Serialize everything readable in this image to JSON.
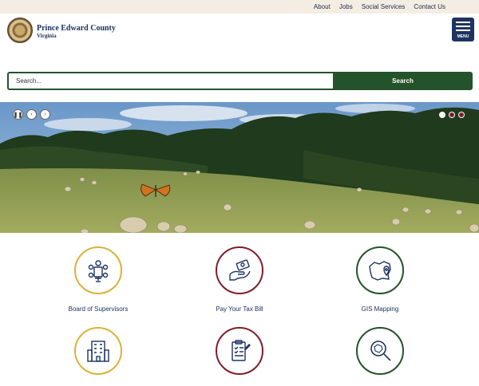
{
  "utility_nav": [
    "About",
    "Jobs",
    "Social Services",
    "Contact Us"
  ],
  "site": {
    "name": "Prince Edward County",
    "state": "Virginia"
  },
  "menu": {
    "label": "MENU"
  },
  "search": {
    "placeholder": "Search...",
    "button_label": "Search"
  },
  "carousel": {
    "slide_count": 3,
    "active_slide": 1
  },
  "quick_links": [
    {
      "label": "Board of Supervisors",
      "icon": "board-meeting-icon",
      "color": "#d9b23a"
    },
    {
      "label": "Pay Your Tax Bill",
      "icon": "money-hand-icon",
      "color": "#7f1d2a"
    },
    {
      "label": "GIS Mapping",
      "icon": "map-pin-icon",
      "color": "#24522a"
    },
    {
      "label": "",
      "icon": "building-icon",
      "color": "#d9b23a"
    },
    {
      "label": "",
      "icon": "clipboard-checklist-icon",
      "color": "#7f1d2a"
    },
    {
      "label": "",
      "icon": "magnify-map-icon",
      "color": "#24522a"
    }
  ],
  "colors": {
    "navy": "#1d3360",
    "green": "#24522a",
    "maroon": "#7f1d2a",
    "gold": "#d9b23a",
    "utility_bg": "#f4ede4"
  }
}
